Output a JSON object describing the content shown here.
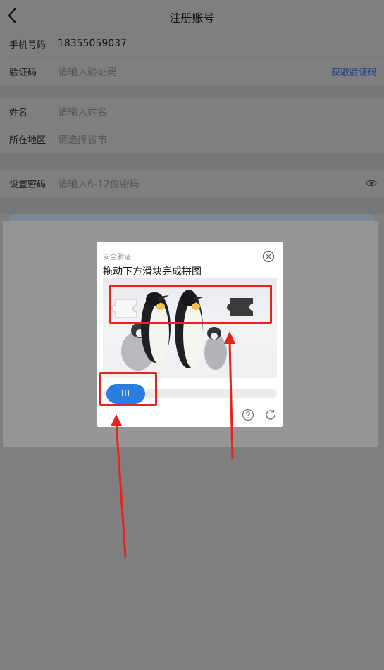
{
  "header": {
    "title": "注册账号",
    "back_icon": "chevron-left-icon"
  },
  "form": {
    "phone": {
      "label": "手机号码",
      "value": "18355059037"
    },
    "code": {
      "label": "验证码",
      "placeholder": "请输入验证码",
      "action": "获取验证码"
    },
    "name": {
      "label": "姓名",
      "placeholder": "请输入姓名"
    },
    "region": {
      "label": "所在地区",
      "placeholder": "请选择省市"
    },
    "password": {
      "label": "设置密码",
      "placeholder": "请输入6-12位密码",
      "toggle_icon": "eye-icon"
    }
  },
  "captcha": {
    "header": "安全验证",
    "instruction": "拖动下方滑块完成拼图",
    "handle_label": "III",
    "close_icon": "close-circle-icon",
    "help_icon": "help-circle-icon",
    "refresh_icon": "refresh-icon"
  },
  "colors": {
    "accent": "#2a7de1",
    "annotation": "#e8231f",
    "link": "#1d3f88"
  }
}
